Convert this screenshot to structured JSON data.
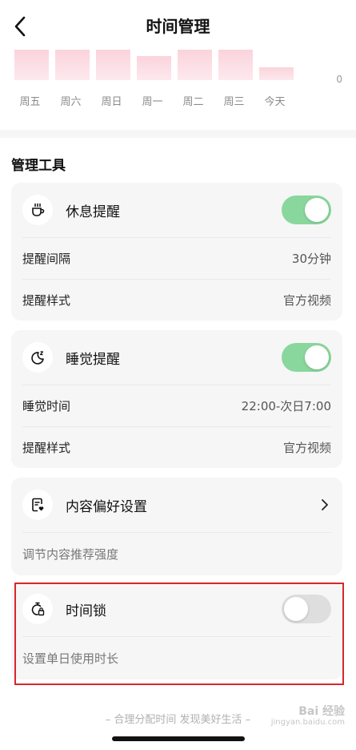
{
  "header": {
    "title": "时间管理"
  },
  "chart_data": {
    "type": "bar",
    "categories": [
      "周五",
      "周六",
      "周日",
      "周一",
      "周二",
      "周三",
      "今天"
    ],
    "values": [
      0.95,
      0.95,
      0.95,
      0.75,
      0.95,
      0.95,
      0.4
    ],
    "ylim": [
      0,
      1
    ],
    "y_tick_label": "0"
  },
  "section": {
    "title": "管理工具"
  },
  "rest_reminder": {
    "title": "休息提醒",
    "enabled": true,
    "rows": [
      {
        "label": "提醒间隔",
        "value": "30分钟"
      },
      {
        "label": "提醒样式",
        "value": "官方视频"
      }
    ]
  },
  "sleep_reminder": {
    "title": "睡觉提醒",
    "enabled": true,
    "rows": [
      {
        "label": "睡觉时间",
        "value": "22:00-次日7:00"
      },
      {
        "label": "提醒样式",
        "value": "官方视频"
      }
    ]
  },
  "content_pref": {
    "title": "内容偏好设置",
    "hint": "调节内容推荐强度"
  },
  "time_lock": {
    "title": "时间锁",
    "enabled": false,
    "hint": "设置单日使用时长"
  },
  "footer": {
    "slogan": "– 合理分配时间 发现美好生活 –"
  },
  "watermark": {
    "brand": "Bai 经验",
    "domain": "jingyan.baidu.com"
  },
  "colors": {
    "toggle_on": "#89d79d",
    "toggle_off": "#dedede",
    "bar": "#fbd3dc",
    "highlight": "#d9262c"
  }
}
